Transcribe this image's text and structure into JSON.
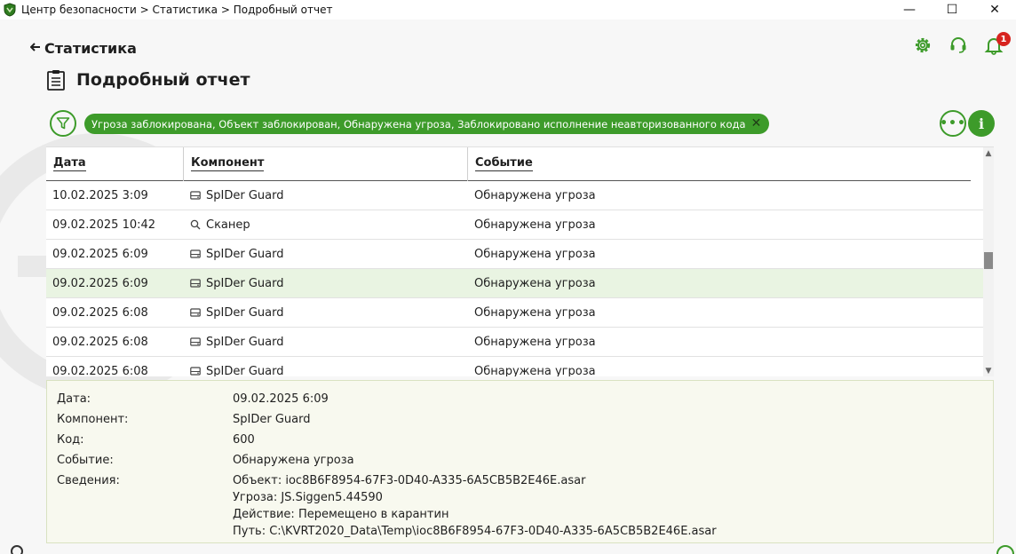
{
  "titlebar": {
    "path": "Центр безопасности > Статистика > Подробный отчет",
    "minimize": "—",
    "maximize": "☐",
    "close": "✕"
  },
  "header": {
    "back_label": "Статистика",
    "page_title": "Подробный отчет",
    "notifications_count": "1"
  },
  "filter": {
    "chip_text": "Угроза заблокирована, Объект заблокирован, Обнаружена угроза, Заблокировано исполнение неавторизованного кода"
  },
  "table": {
    "columns": [
      "Дата",
      "Компонент",
      "Событие"
    ],
    "rows": [
      {
        "date": "10.02.2025 3:09",
        "component": "SpIDer Guard",
        "icon": "drive-icon",
        "event": "Обнаружена угроза"
      },
      {
        "date": "09.02.2025 10:42",
        "component": "Сканер",
        "icon": "search-icon",
        "event": "Обнаружена угроза"
      },
      {
        "date": "09.02.2025 6:09",
        "component": "SpIDer Guard",
        "icon": "drive-icon",
        "event": "Обнаружена угроза"
      },
      {
        "date": "09.02.2025 6:09",
        "component": "SpIDer Guard",
        "icon": "drive-icon",
        "event": "Обнаружена угроза",
        "selected": true
      },
      {
        "date": "09.02.2025 6:08",
        "component": "SpIDer Guard",
        "icon": "drive-icon",
        "event": "Обнаружена угроза"
      },
      {
        "date": "09.02.2025 6:08",
        "component": "SpIDer Guard",
        "icon": "drive-icon",
        "event": "Обнаружена угроза"
      },
      {
        "date": "09.02.2025 6:08",
        "component": "SpIDer Guard",
        "icon": "drive-icon",
        "event": "Обнаружена угроза"
      }
    ]
  },
  "details": {
    "date_label": "Дата:",
    "date_value": "09.02.2025 6:09",
    "component_label": "Компонент:",
    "component_value": "SpIDer Guard",
    "code_label": "Код:",
    "code_value": "600",
    "event_label": "Событие:",
    "event_value": "Обнаружена угроза",
    "info_label": "Сведения:",
    "info_lines": [
      "Объект: ioc8B6F8954-67F3-0D40-A335-6A5CB5B2E46E.asar",
      "Угроза: JS.Siggen5.44590",
      "Действие: Перемещено в карантин",
      "Путь: C:\\KVRT2020_Data\\Temp\\ioc8B6F8954-67F3-0D40-A335-6A5CB5B2E46E.asar"
    ]
  },
  "colors": {
    "accent": "#3d9b2a",
    "selected_row": "#e9f4e2",
    "badge": "#d7231f"
  }
}
